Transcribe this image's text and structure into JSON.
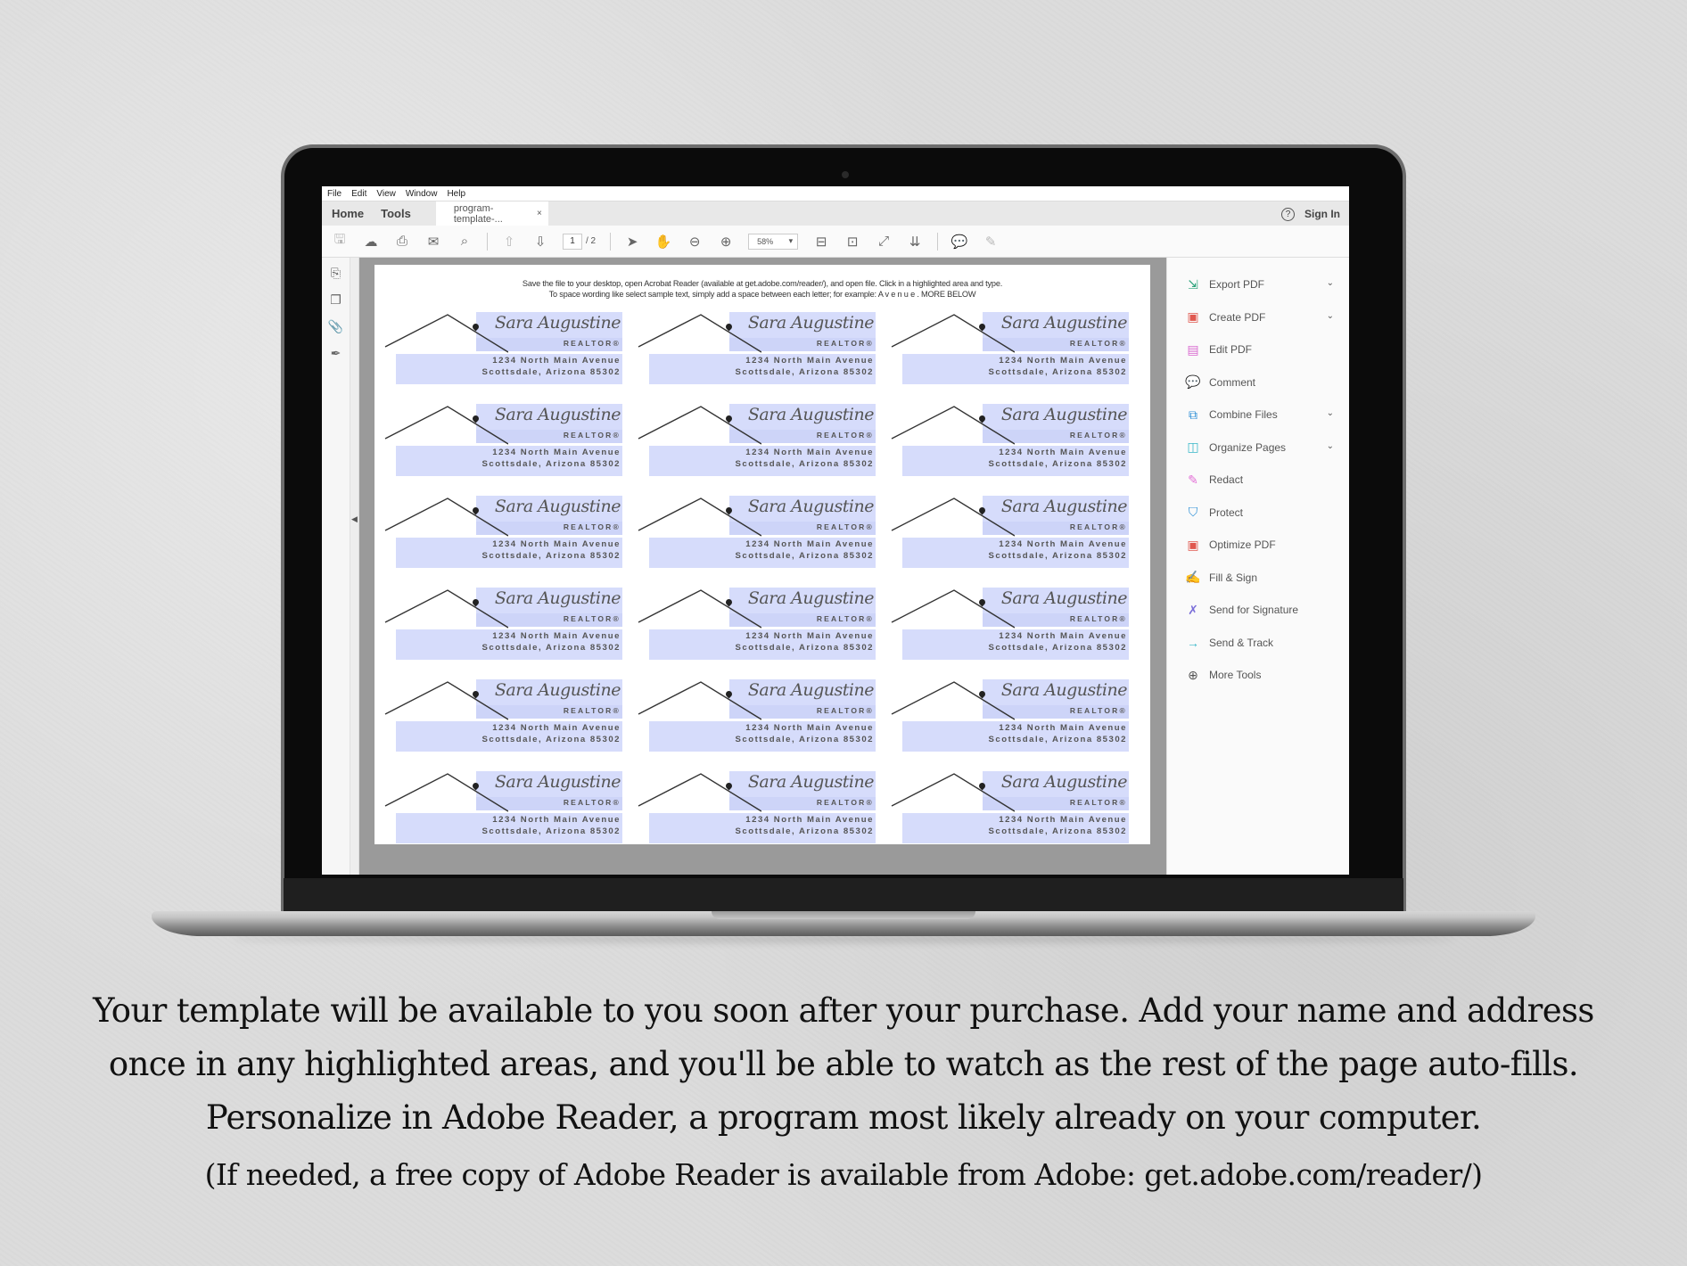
{
  "menu": [
    "File",
    "Edit",
    "View",
    "Window",
    "Help"
  ],
  "nav": {
    "home": "Home",
    "tools": "Tools"
  },
  "doc_tab": {
    "title": "program-template-...",
    "close": "×"
  },
  "header_right": {
    "help": "?",
    "sign_in": "Sign In"
  },
  "toolbar": {
    "page_current": "1",
    "page_total": "/ 2",
    "zoom": "58%",
    "zoom_caret": "▾"
  },
  "document": {
    "instructions_line1": "Save the file to your desktop, open Acrobat Reader (available at get.adobe.com/reader/), and open file. Click in a highlighted area and type.",
    "instructions_line2": "To space wording like select sample text, simply add a space between each letter; for example: A v e n u e .  MORE BELOW",
    "label": {
      "name": "Sara Augustine",
      "title": "REALTOR®",
      "address_line1": "1234 North Main Avenue",
      "address_line2": "Scottsdale, Arizona 85302"
    },
    "label_count": 18,
    "highlight_color": "#d6dcfb"
  },
  "tools_pane": [
    {
      "label": "Export PDF",
      "icon": "export-pdf-icon",
      "glyph": "⇲",
      "color": "#2aa37a",
      "chevron": true
    },
    {
      "label": "Create PDF",
      "icon": "create-pdf-icon",
      "glyph": "▣",
      "color": "#e0584f",
      "chevron": true
    },
    {
      "label": "Edit PDF",
      "icon": "edit-pdf-icon",
      "glyph": "▤",
      "color": "#d96ad0",
      "chevron": false
    },
    {
      "label": "Comment",
      "icon": "comment-icon",
      "glyph": "💬",
      "color": "#e9b63e",
      "chevron": false
    },
    {
      "label": "Combine Files",
      "icon": "combine-files-icon",
      "glyph": "⧉",
      "color": "#2d8fd6",
      "chevron": true
    },
    {
      "label": "Organize Pages",
      "icon": "organize-pages-icon",
      "glyph": "◫",
      "color": "#39b7c9",
      "chevron": true
    },
    {
      "label": "Redact",
      "icon": "redact-icon",
      "glyph": "✎",
      "color": "#e36fd6",
      "chevron": false
    },
    {
      "label": "Protect",
      "icon": "protect-icon",
      "glyph": "⛉",
      "color": "#2d8fd6",
      "chevron": false
    },
    {
      "label": "Optimize PDF",
      "icon": "optimize-pdf-icon",
      "glyph": "▣",
      "color": "#e0584f",
      "chevron": false
    },
    {
      "label": "Fill & Sign",
      "icon": "fill-sign-icon",
      "glyph": "✍",
      "color": "#7b6fd9",
      "chevron": false
    },
    {
      "label": "Send for Signature",
      "icon": "send-signature-icon",
      "glyph": "✗",
      "color": "#7b6fd9",
      "chevron": false
    },
    {
      "label": "Send & Track",
      "icon": "send-track-icon",
      "glyph": "→",
      "color": "#39b7c9",
      "chevron": false
    },
    {
      "label": "More Tools",
      "icon": "more-tools-icon",
      "glyph": "⊕",
      "color": "#555555",
      "chevron": false
    }
  ],
  "caption": {
    "line1": "Your template will be available to you soon after your purchase.  Add your name and address",
    "line2": "once in any highlighted areas, and you'll be able to watch as the rest of the page auto-fills.",
    "line3": "Personalize in Adobe Reader, a program most likely already on your computer.",
    "line4": "(If needed, a free copy of Adobe Reader is available from Adobe: get.adobe.com/reader/)"
  }
}
